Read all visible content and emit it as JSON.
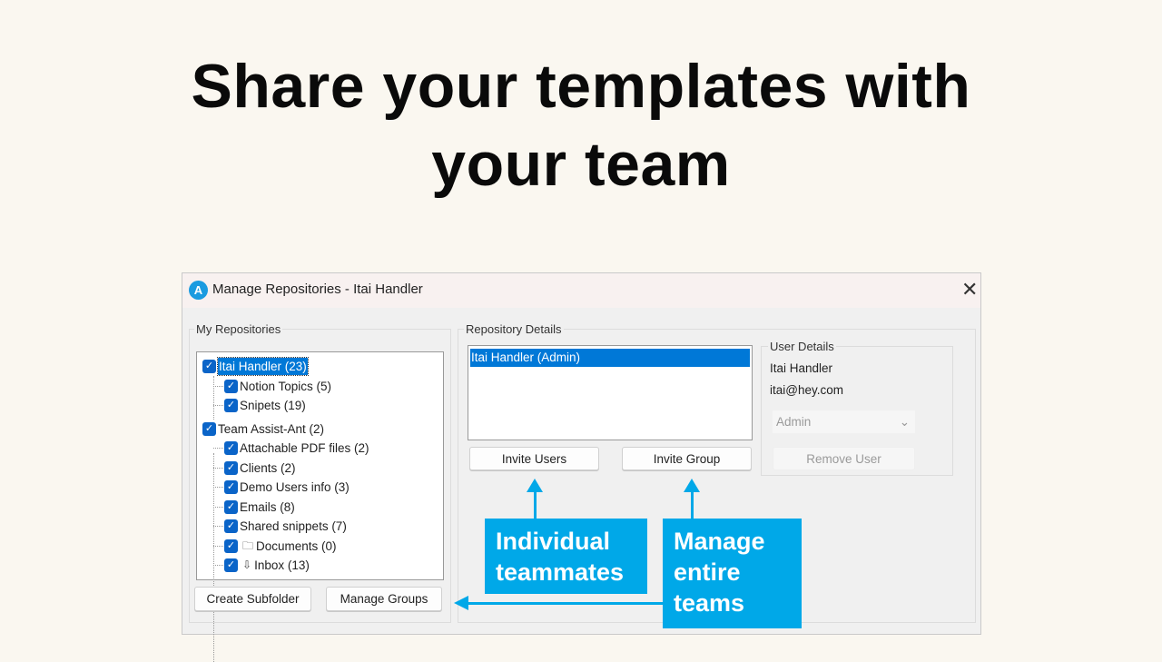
{
  "headline": {
    "line1": "Share your templates with",
    "line2": "your team"
  },
  "window": {
    "title": "Manage Repositories - Itai Handler",
    "icon": "A",
    "close": "✕"
  },
  "my_repos": {
    "label": "My Repositories",
    "tree": [
      {
        "label": "Itai Handler (23)",
        "level": 0,
        "checked": true,
        "selected": true
      },
      {
        "label": "Notion Topics (5)",
        "level": 1,
        "checked": true
      },
      {
        "label": "Snipets (19)",
        "level": 1,
        "checked": true
      },
      {
        "label": "Team Assist-Ant (2)",
        "level": 0,
        "checked": true
      },
      {
        "label": "Attachable PDF files (2)",
        "level": 1,
        "checked": true
      },
      {
        "label": "Clients (2)",
        "level": 1,
        "checked": true
      },
      {
        "label": "Demo Users info (3)",
        "level": 1,
        "checked": true
      },
      {
        "label": "Emails (8)",
        "level": 1,
        "checked": true
      },
      {
        "label": "Shared snippets (7)",
        "level": 1,
        "checked": true
      },
      {
        "label": "Documents (0)",
        "level": 1,
        "checked": true,
        "icon": "folder-icon"
      },
      {
        "label": "Inbox (13)",
        "level": 1,
        "checked": true,
        "icon": "inbox-icon"
      }
    ],
    "create_subfolder": "Create Subfolder",
    "manage_groups": "Manage Groups"
  },
  "repo_details": {
    "label": "Repository Details",
    "users": [
      "Itai Handler (Admin)"
    ],
    "invite_users": "Invite Users",
    "invite_group": "Invite Group"
  },
  "user_details": {
    "label": "User Details",
    "name": "Itai Handler",
    "email": "itai@hey.com",
    "role": "Admin",
    "remove_user": "Remove User"
  },
  "callouts": {
    "individual": {
      "line1": "Individual",
      "line2": "teammates"
    },
    "teams": {
      "line1": "Manage",
      "line2": "entire",
      "line3": "teams"
    }
  },
  "colors": {
    "accent": "#00a8e8",
    "selection": "#0078d7",
    "background": "#faf7f0"
  }
}
